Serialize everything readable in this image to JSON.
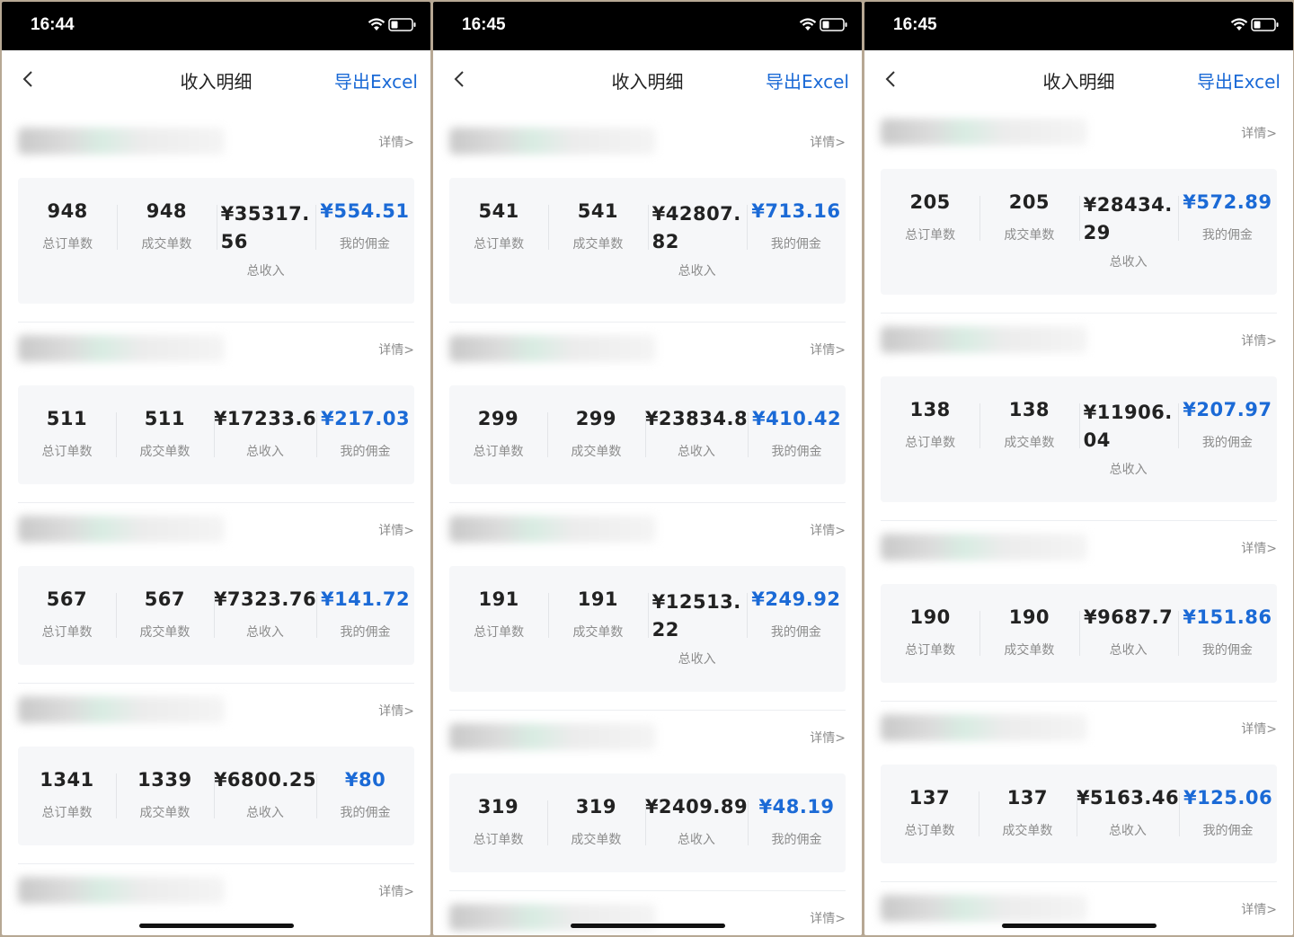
{
  "screens": [
    {
      "time": "16:44",
      "title": "收入明细",
      "export": "导出Excel",
      "entries": [
        {
          "detail": "详情>",
          "stats": [
            {
              "value": "948",
              "label": "总订单数"
            },
            {
              "value": "948",
              "label": "成交单数"
            },
            {
              "value": "¥35317.56",
              "label": "总收入"
            },
            {
              "value": "¥554.51",
              "label": "我的佣金"
            }
          ]
        },
        {
          "detail": "详情>",
          "stats": [
            {
              "value": "511",
              "label": "总订单数"
            },
            {
              "value": "511",
              "label": "成交单数"
            },
            {
              "value": "¥17233.6",
              "label": "总收入"
            },
            {
              "value": "¥217.03",
              "label": "我的佣金"
            }
          ]
        },
        {
          "detail": "详情>",
          "stats": [
            {
              "value": "567",
              "label": "总订单数"
            },
            {
              "value": "567",
              "label": "成交单数"
            },
            {
              "value": "¥7323.76",
              "label": "总收入"
            },
            {
              "value": "¥141.72",
              "label": "我的佣金"
            }
          ]
        },
        {
          "detail": "详情>",
          "stats": [
            {
              "value": "1341",
              "label": "总订单数"
            },
            {
              "value": "1339",
              "label": "成交单数"
            },
            {
              "value": "¥6800.25",
              "label": "总收入"
            },
            {
              "value": "¥80",
              "label": "我的佣金"
            }
          ]
        },
        {
          "detail": "详情>"
        }
      ]
    },
    {
      "time": "16:45",
      "title": "收入明细",
      "export": "导出Excel",
      "entries": [
        {
          "detail": "详情>",
          "stats": [
            {
              "value": "541",
              "label": "总订单数"
            },
            {
              "value": "541",
              "label": "成交单数"
            },
            {
              "value": "¥42807.82",
              "label": "总收入"
            },
            {
              "value": "¥713.16",
              "label": "我的佣金"
            }
          ]
        },
        {
          "detail": "详情>",
          "stats": [
            {
              "value": "299",
              "label": "总订单数"
            },
            {
              "value": "299",
              "label": "成交单数"
            },
            {
              "value": "¥23834.8",
              "label": "总收入"
            },
            {
              "value": "¥410.42",
              "label": "我的佣金"
            }
          ]
        },
        {
          "detail": "详情>",
          "stats": [
            {
              "value": "191",
              "label": "总订单数"
            },
            {
              "value": "191",
              "label": "成交单数"
            },
            {
              "value": "¥12513.22",
              "label": "总收入"
            },
            {
              "value": "¥249.92",
              "label": "我的佣金"
            }
          ]
        },
        {
          "detail": "详情>",
          "stats": [
            {
              "value": "319",
              "label": "总订单数"
            },
            {
              "value": "319",
              "label": "成交单数"
            },
            {
              "value": "¥2409.89",
              "label": "总收入"
            },
            {
              "value": "¥48.19",
              "label": "我的佣金"
            }
          ]
        },
        {
          "detail": "详情>"
        }
      ]
    },
    {
      "time": "16:45",
      "title": "收入明细",
      "export": "导出Excel",
      "entries": [
        {
          "detail": "详情>",
          "stats": [
            {
              "value": "205",
              "label": "总订单数"
            },
            {
              "value": "205",
              "label": "成交单数"
            },
            {
              "value": "¥28434.29",
              "label": "总收入"
            },
            {
              "value": "¥572.89",
              "label": "我的佣金"
            }
          ]
        },
        {
          "detail": "详情>",
          "stats": [
            {
              "value": "138",
              "label": "总订单数"
            },
            {
              "value": "138",
              "label": "成交单数"
            },
            {
              "value": "¥11906.04",
              "label": "总收入"
            },
            {
              "value": "¥207.97",
              "label": "我的佣金"
            }
          ]
        },
        {
          "detail": "详情>",
          "stats": [
            {
              "value": "190",
              "label": "总订单数"
            },
            {
              "value": "190",
              "label": "成交单数"
            },
            {
              "value": "¥9687.7",
              "label": "总收入"
            },
            {
              "value": "¥151.86",
              "label": "我的佣金"
            }
          ]
        },
        {
          "detail": "详情>",
          "stats": [
            {
              "value": "137",
              "label": "总订单数"
            },
            {
              "value": "137",
              "label": "成交单数"
            },
            {
              "value": "¥5163.46",
              "label": "总收入"
            },
            {
              "value": "¥125.06",
              "label": "我的佣金"
            }
          ]
        },
        {
          "detail": "详情>"
        }
      ]
    }
  ],
  "colors": {
    "accent": "#1b6ad6",
    "label": "#8c8c8c",
    "card": "#f6f7f9"
  }
}
